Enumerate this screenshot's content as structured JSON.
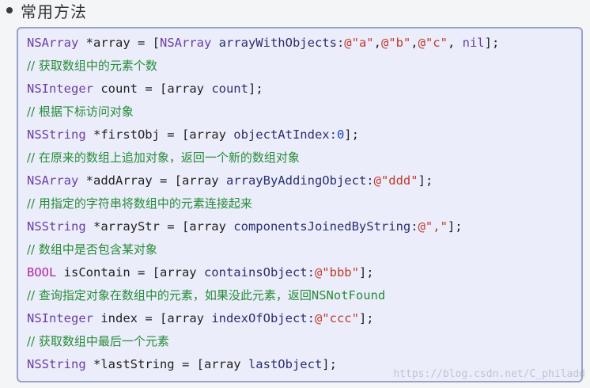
{
  "heading": "常用方法",
  "lines": [
    {
      "kind": "code",
      "parts": [
        [
          "kw",
          "NSArray"
        ],
        [
          "txt",
          " *array = ["
        ],
        [
          "kw",
          "NSArray"
        ],
        [
          "meth",
          " arrayWithObjects:"
        ],
        [
          "str",
          "@\"a\""
        ],
        [
          "txt",
          ","
        ],
        [
          "str",
          "@\"b\""
        ],
        [
          "txt",
          ","
        ],
        [
          "str",
          "@\"c\""
        ],
        [
          "txt",
          ", "
        ],
        [
          "kw",
          "nil"
        ],
        [
          "txt",
          "];"
        ]
      ]
    },
    {
      "kind": "comment",
      "text": "// 获取数组中的元素个数"
    },
    {
      "kind": "code",
      "parts": [
        [
          "kw",
          "NSInteger"
        ],
        [
          "txt",
          " count = [array "
        ],
        [
          "meth",
          "count"
        ],
        [
          "txt",
          "];"
        ]
      ]
    },
    {
      "kind": "comment",
      "text": "// 根据下标访问对象"
    },
    {
      "kind": "code",
      "parts": [
        [
          "kw",
          "NSString"
        ],
        [
          "txt",
          " *firstObj = [array "
        ],
        [
          "meth",
          "objectAtIndex:"
        ],
        [
          "num",
          "0"
        ],
        [
          "txt",
          "];"
        ]
      ]
    },
    {
      "kind": "comment",
      "text": "// 在原来的数组上追加对象，返回一个新的数组对象"
    },
    {
      "kind": "code",
      "parts": [
        [
          "kw",
          "NSArray"
        ],
        [
          "txt",
          " *addArray = [array "
        ],
        [
          "meth",
          "arrayByAddingObject:"
        ],
        [
          "str",
          "@\"ddd\""
        ],
        [
          "txt",
          "];"
        ]
      ]
    },
    {
      "kind": "comment",
      "text": "// 用指定的字符串将数组中的元素连接起来"
    },
    {
      "kind": "code",
      "parts": [
        [
          "kw",
          "NSString"
        ],
        [
          "txt",
          " *arrayStr = [array "
        ],
        [
          "meth",
          "componentsJoinedByString:"
        ],
        [
          "str",
          "@\",\""
        ],
        [
          "txt",
          "];"
        ]
      ]
    },
    {
      "kind": "comment",
      "text": "// 数组中是否包含某对象"
    },
    {
      "kind": "code",
      "parts": [
        [
          "boolkw",
          "BOOL"
        ],
        [
          "txt",
          " isContain = [array "
        ],
        [
          "meth",
          "containsObject:"
        ],
        [
          "str",
          "@\"bbb\""
        ],
        [
          "txt",
          "];"
        ]
      ]
    },
    {
      "kind": "comment",
      "text": "// 查询指定对象在数组中的元素，如果没此元素，返回",
      "suffix": "NSNotFound"
    },
    {
      "kind": "code",
      "parts": [
        [
          "kw",
          "NSInteger"
        ],
        [
          "txt",
          " index = [array "
        ],
        [
          "meth",
          "indexOfObject:"
        ],
        [
          "str",
          "@\"ccc\""
        ],
        [
          "txt",
          "];"
        ]
      ]
    },
    {
      "kind": "comment",
      "text": "// 获取数组中最后一个元素"
    },
    {
      "kind": "code",
      "parts": [
        [
          "kw",
          "NSString"
        ],
        [
          "txt",
          " *lastString = [array "
        ],
        [
          "meth",
          "lastObject"
        ],
        [
          "txt",
          "];"
        ]
      ]
    }
  ],
  "watermark": "https://blog.csdn.net/C_philadd"
}
